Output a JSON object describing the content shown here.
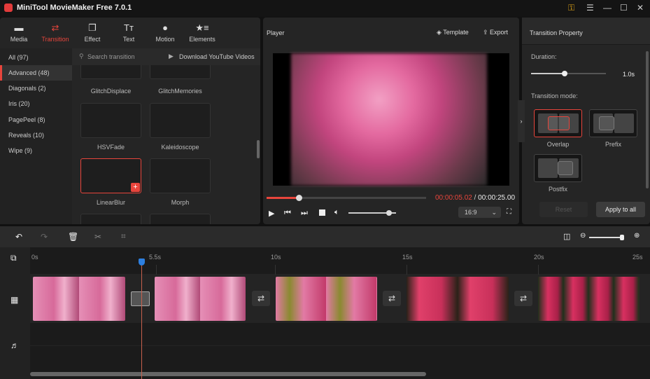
{
  "app": {
    "title": "MiniTool MovieMaker Free 7.0.1"
  },
  "toolbar": {
    "tabs": [
      {
        "label": "Media",
        "icon": "folder-icon"
      },
      {
        "label": "Transition",
        "icon": "transition-icon"
      },
      {
        "label": "Effect",
        "icon": "effect-icon"
      },
      {
        "label": "Text",
        "icon": "text-icon"
      },
      {
        "label": "Motion",
        "icon": "motion-icon"
      },
      {
        "label": "Elements",
        "icon": "elements-icon"
      }
    ],
    "active": "Transition"
  },
  "categories": [
    {
      "label": "All (97)"
    },
    {
      "label": "Advanced (48)"
    },
    {
      "label": "Diagonals (2)"
    },
    {
      "label": "Iris (20)"
    },
    {
      "label": "PagePeel (8)"
    },
    {
      "label": "Reveals (10)"
    },
    {
      "label": "Wipe (9)"
    }
  ],
  "search": {
    "placeholder": "Search transition"
  },
  "download_label": "Download YouTube Videos",
  "transitions": [
    {
      "label": "GlitchDisplace"
    },
    {
      "label": "GlitchMemories"
    },
    {
      "label": "HSVFade"
    },
    {
      "label": "Kaleidoscope"
    },
    {
      "label": "LinearBlur"
    },
    {
      "label": "Morph"
    }
  ],
  "player": {
    "title": "Player",
    "template_label": "Template",
    "export_label": "Export",
    "current_time": "00:00:05.02",
    "separator": " / ",
    "total_time": "00:00:25.00",
    "progress": 0.2,
    "volume": 0.85,
    "aspect": "16:9"
  },
  "property": {
    "title": "Transition Property",
    "duration_label": "Duration:",
    "duration_value": "1.0s",
    "duration_fraction": 0.45,
    "mode_label": "Transition mode:",
    "modes": [
      {
        "label": "Overlap"
      },
      {
        "label": "Prefix"
      },
      {
        "label": "Postfix"
      }
    ],
    "selected_mode": "Overlap",
    "reset_label": "Reset",
    "apply_label": "Apply to all"
  },
  "timeline": {
    "ticks": [
      "0s",
      "5.5s",
      "10s",
      "15s",
      "20s",
      "25s"
    ],
    "playhead": "5.5s",
    "accent": "#e8453c",
    "playhead_color": "#2d7fe0"
  }
}
